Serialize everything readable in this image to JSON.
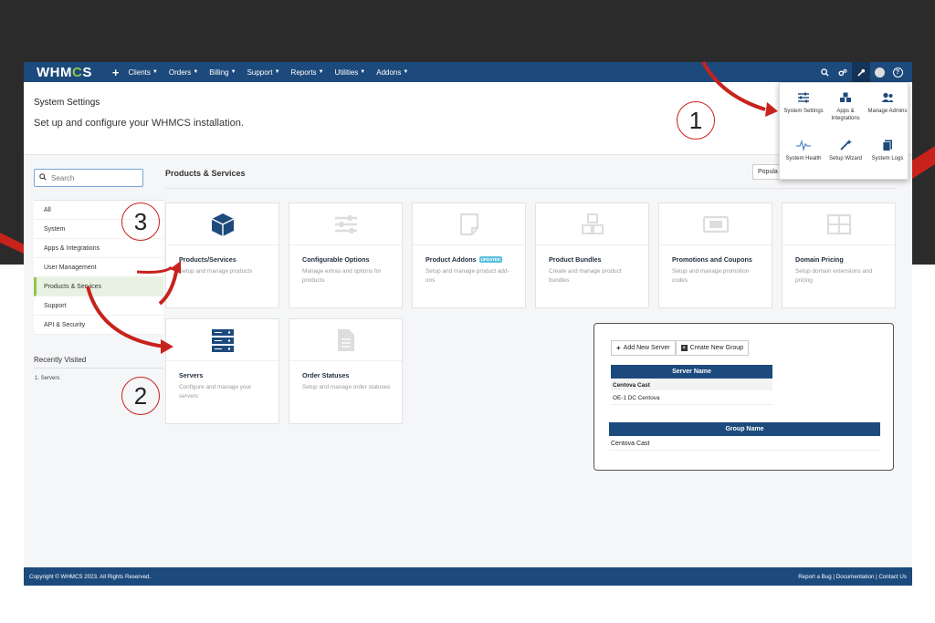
{
  "navbar": {
    "logo": "WHMCS",
    "plus": "+",
    "menu": [
      {
        "label": "Clients"
      },
      {
        "label": "Orders"
      },
      {
        "label": "Billing"
      },
      {
        "label": "Support"
      },
      {
        "label": "Reports"
      },
      {
        "label": "Utilities"
      },
      {
        "label": "Addons"
      }
    ],
    "icons": [
      "search-icon",
      "cogs-icon",
      "wrench-icon",
      "avatar-icon",
      "help-icon"
    ],
    "help_label": "?",
    "color": "#1d4a7c"
  },
  "header": {
    "title": "System Settings",
    "subtitle": "Set up and configure your WHMCS installation."
  },
  "sidebar": {
    "search_placeholder": "Search",
    "items": [
      {
        "label": "All"
      },
      {
        "label": "System"
      },
      {
        "label": "Apps & Integrations"
      },
      {
        "label": "User Management"
      },
      {
        "label": "Products & Services",
        "active": true
      },
      {
        "label": "Support"
      },
      {
        "label": "API & Security"
      }
    ],
    "recent_title": "Recently Visited",
    "recent_items": [
      "1. Servers"
    ]
  },
  "content": {
    "section_title": "Products & Services",
    "popular_label": "Popula",
    "cards": [
      {
        "title": "Products/Services",
        "desc": "Setup and manage products",
        "icon": "box-icon"
      },
      {
        "title": "Configurable Options",
        "desc": "Manage extras and options for products",
        "icon": "sliders-icon"
      },
      {
        "title": "Product Addons",
        "badge": "UPDATED",
        "desc": "Setup and manage product add-ons",
        "icon": "addon-icon"
      },
      {
        "title": "Product Bundles",
        "desc": "Create and manage product bundles",
        "icon": "cubes-icon"
      },
      {
        "title": "Promotions and Coupons",
        "desc": "Setup and manage promotion codes",
        "icon": "ticket-icon"
      },
      {
        "title": "Domain Pricing",
        "desc": "Setup domain extensions and pricing",
        "icon": "grid-icon"
      },
      {
        "title": "Servers",
        "desc": "Configure and manage your servers",
        "icon": "server-icon"
      },
      {
        "title": "Order Statuses",
        "desc": "Setup and manage order statuses",
        "icon": "document-icon"
      }
    ]
  },
  "dropdown": {
    "items": [
      {
        "label": "System Settings",
        "icon": "sliders-icon"
      },
      {
        "label": "Apps & Integrations",
        "icon": "apps-icon"
      },
      {
        "label": "Manage Admins",
        "icon": "users-icon"
      },
      {
        "label": "System Health",
        "icon": "pulse-icon"
      },
      {
        "label": "Setup Wizard",
        "icon": "wand-icon"
      },
      {
        "label": "System Logs",
        "icon": "logs-icon"
      }
    ]
  },
  "server_panel": {
    "add_server": "Add New Server",
    "create_group": "Create New Group",
    "server_name_header": "Server Name",
    "group_row": "Centova Cast",
    "server_row": "OE-1 DC Centova",
    "group_name_header": "Group Name",
    "group_value": "Centova Cast"
  },
  "footer": {
    "copyright": "Copyright © WHMCS 2023. All Rights Reserved.",
    "links": "Report a Bug | Documentation | Contact Us"
  },
  "annotations": [
    "1",
    "2",
    "3"
  ],
  "colors": {
    "annotation": "#c8221c",
    "accent": "#8fc74a",
    "brand": "#1d4a7c"
  }
}
